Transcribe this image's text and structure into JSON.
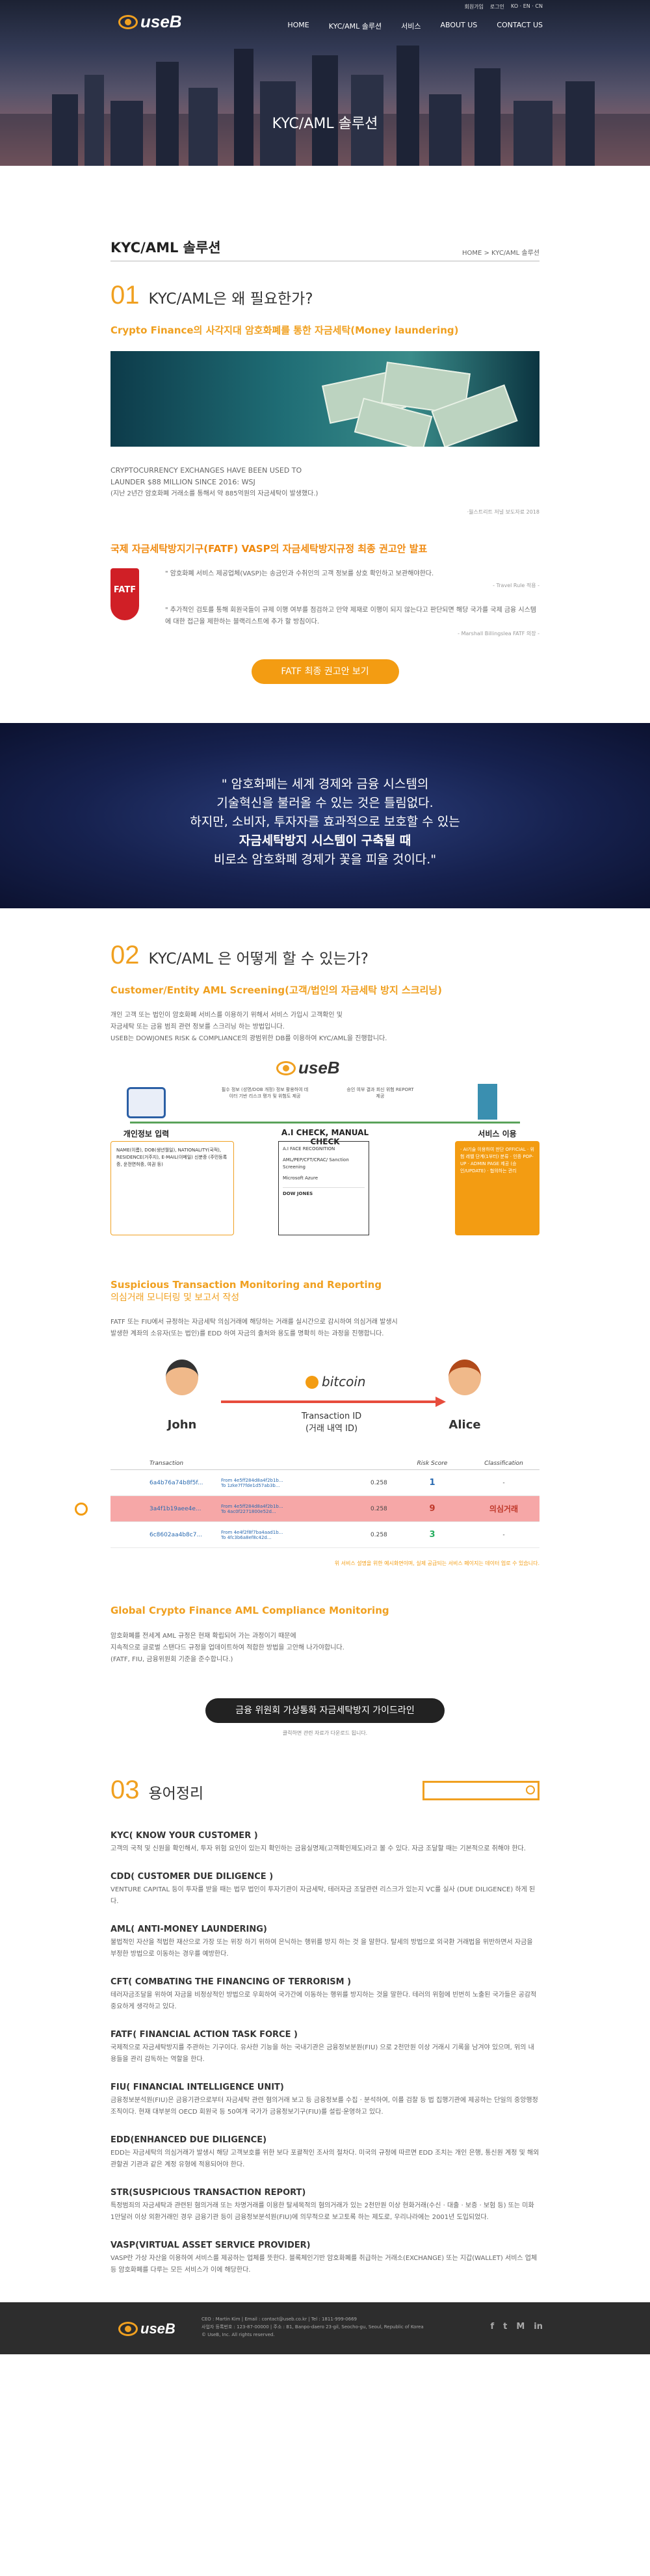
{
  "header": {
    "logo_text": "useB",
    "top_links": [
      "회원가입",
      "로그인",
      "KO · EN · CN"
    ],
    "nav": [
      "HOME",
      "KYC/AML 솔루션",
      "서비스",
      "ABOUT US",
      "CONTACT US"
    ]
  },
  "hero": {
    "title": "KYC/AML 솔루션"
  },
  "page": {
    "title": "KYC/AML 솔루션",
    "breadcrumb": "HOME  >  KYC/AML 솔루션"
  },
  "section1": {
    "num": "01",
    "title": "KYC/AML은 왜 필요한가?",
    "subtitle": "Crypto Finance의 사각지대 암호화폐를 통한 자금세탁(Money laundering)",
    "image_caption_en": "CRYPTOCURRENCY EXCHANGES HAVE BEEN USED TO LAUNDER $88 MILLION SINCE 2016: WSJ",
    "image_caption_ko": "(지난 2년간 암호화폐 거래소를 통해서 약 885억원의 자금세탁이 발생했다.)",
    "image_source": "·월스트리트 저널 보도자료 2018",
    "fatf_heading": "국제 자금세탁방지기구(FATF) VASP의 자금세탁방지규정 최종 권고안 발표",
    "fatf_logo": "FATF",
    "quote1": "\" 암호화폐 서비스 제공업체(VASP)는 송금인과 수취인의 고객 정보를 상호 확인하고 보관해야한다.",
    "quote1_src": "- Travel Rule 적용 -",
    "quote2": "\" 추가적인 검토를 통해 회원국들이 규제 이행 여부를 점검하고 만약 제재로 이행이 되지 않는다고 판단되면 해당 국가를 국제 금융 시스템에 대한 접근을 제한하는 블랙리스트에 추가 할 방침이다.",
    "quote2_src": "- Marshall Billingslea FATF 의장 -",
    "button": "FATF 최종 권고안 보기"
  },
  "quote_band": {
    "line1": "\" 암호화폐는 세계 경제와 금융 시스템의",
    "line2": "기술혁신을 불러올 수 있는 것은 틀림없다.",
    "line3": "하지만, 소비자, 투자자를 효과적으로 보호할 수 있는",
    "line4": "자금세탁방지 시스템이 구축될 때",
    "line5": "비로소 암호화폐 경제가 꽃을 피울 것이다.\""
  },
  "section2": {
    "num": "02",
    "title": "KYC/AML 은 어떻게 할 수 있는가?",
    "sub1": "Customer/Entity AML Screening(고객/법인의 자금세탁 방지 스크리닝)",
    "sub1_text1": "개인 고객 또는 법인이 암호화폐 서비스를 이용하기 위해서 서비스 가입시 고객확인 및",
    "sub1_text2": "자금세탁 또는 금융 범죄 관련 정보를 스크리닝 하는 방법입니다.",
    "sub1_text3": "USEB는 DOWJONES RISK & COMPLIANCE의 광범위한 DB를 이용하여 KYC/AML을 진행합니다.",
    "diag_logo": "useB",
    "diag_note_left": "필수 정보 (성명/DOB 개정) 정보 활용하여 데이터 기반 리스크 평가 및 위험도 제공",
    "diag_note_right": "승인 여부 결과 회신 위험 REPORT 제공",
    "col1_title": "개인정보 입력",
    "col2_title": "A.I CHECK, MANUAL CHECK",
    "col3_title": "서비스 이용",
    "col1_text": "NAME(이름), DOB(생년월일), NATIONALITY(국적), RESIDENCE(거주지), E-MAIL(이메일) 신분증 (주민등록증, 운전면허증, 여권 등)",
    "col2_items": [
      "A.I FACE RECOGNITION",
      "AML/PEP/CFT/CRAC/ Sanction Screening",
      "Microsoft Azure",
      "DOW JONES"
    ],
    "col3_text": "· AI기술 이용하여 판단 OFFICIAL · 위험 레벨 단계(1부터) 분류 · 인증 POP-UP · ADMIN PAGE 제공 (승인/UPDATE) · 협의하는 관리",
    "sub2": "Suspicious Transaction Monitoring and Reporting",
    "sub2_ko": "의심거래 모니터링 및 보고서 작성",
    "sub2_text1": "FATF 또는 FIU에서 규정하는 자금세탁 의심거래에 해당하는 거래를 실시간으로 감시하여 의심거래 발생시",
    "sub2_text2": "발생한 계좌의 소유자(또는 법인)를 EDD 하여 자금의 출처와 용도를 명확히 하는 과정을 진행합니다.",
    "person_left": "John",
    "person_right": "Alice",
    "coin": "bitcoin",
    "tx_label": "Transaction ID",
    "tx_label_ko": "(거래 내역 ID)",
    "table_headers": [
      "Transaction",
      "Risk Score",
      "Classification"
    ],
    "tx_rows": [
      {
        "hash": "6a4b76a74b8f5f...",
        "from": "From 4e5ff284d8a4f2b1b...",
        "to": "To 1zke7f7fde1d57ab3b...",
        "amt": "0.258",
        "score": "1",
        "cls": "-"
      },
      {
        "hash": "3a4f1b19aee4e...",
        "from": "From 4e5ff284d8a4f2b1b...",
        "to": "To 4ac0f2271800e52d...",
        "amt": "0.258",
        "score": "9",
        "cls": "의심거래"
      },
      {
        "hash": "6c8602aa4b8c7...",
        "from": "From 4e4f2f8f7ba4aad1b...",
        "to": "To 4fc3b6a8ef8c42d...",
        "amt": "0.258",
        "score": "3",
        "cls": "-"
      }
    ],
    "tx_note": "위 서비스 설명을 위한 예시화면이며, 실제 공급되는 서비스 페이지는 데이터 업로 수 있습니다.",
    "sub3": "Global Crypto Finance AML Compliance Monitoring",
    "sub3_text1": "암호화폐를 전세계 AML 규정은 현재 확립되어 가는 과정이기 때문에",
    "sub3_text2": "지속적으로 글로벌 스탠다드 규정을 업데이트하여 적합한 방법을 고안해 나가야합니다.",
    "sub3_text3": "(FATF, FIU, 금융위원회 기준을 준수합니다.)",
    "black_button": "금융 위원회 가상통화 자금세탁방지 가이드라인",
    "black_button_note": "클릭하면 관련 자료가 다운로드 됩니다."
  },
  "section3": {
    "num": "03",
    "title": "용어정리",
    "search_placeholder": "",
    "terms": [
      {
        "h": "KYC( KNOW YOUR CUSTOMER )",
        "t": "고객의 국적 및 신원을 확인해서, 투자 위험 요인이 있는지 확인하는 금융실명제(고객확인제도)라고 볼 수 있다. 자금 조달할 때는 기본적으로 취해야 한다."
      },
      {
        "h": "CDD( CUSTOMER DUE DILIGENCE )",
        "t": "VENTURE CAPITAL 등이 투자를 받을 때는 법무 법인이 투자기관이 자금세탁, 테러자금 조달관련 리스크가 있는지 VC를 실사 (DUE DILIGENCE) 하게 된다."
      },
      {
        "h": "AML( ANTI-MONEY LAUNDERING)",
        "t": "불법적인 자산을 적법한 재산으로 가장 또는 위장 하기 위하여 은닉하는 행위를 방지 하는 것 을 말한다. 탈세의 방법으로 외국환 거래법을 위반하면서 자금을 부정한 방법으로 이동하는 경우를 예방한다."
      },
      {
        "h": "CFT( COMBATING THE FINANCING OF TERRORISM )",
        "t": "테러자금조달을 위하여 자금을 비정상적인 방법으로 우회하여 국가간에 이동하는 행위를 방지하는 것을 말한다. 테러의 위험에 빈번히 노출된 국가들은 공감적 중요하게 생각하고 있다."
      },
      {
        "h": "FATF( FINANCIAL ACTION TASK FORCE )",
        "t": "국제적으로 자금세탁방지를 주관하는 기구이다. 유사한 기능을 하는 국내기관은 금융정보분원(FIU) 으로 2천만원 이상 거래시 기록을 남겨야 있으며, 위의 내용들을 관리 감독하는 역할을 한다."
      },
      {
        "h": "FIU( FINANCIAL INTELLIGENCE UNIT)",
        "t": "금융정보분석원(FIU)은 금융기관으로부터 자금세탁 관련 혐의거래 보고 등 금융정보를 수집 · 분석하여, 이를 검찰 등 법 집행기관에 제공하는 단일의 중앙행정조직이다. 현재 대부분의 OECD 회원국 등 50여개 국가가 금융정보기구(FIU)를 설립·운영하고 있다."
      },
      {
        "h": "EDD(ENHANCED DUE DILIGENCE)",
        "t": "EDD는 자금세탁의 의심거래가 발생시 해당 고객보호를 위한 보다 포괄적인 조사의 절차다. 미국의 규정에 따르면 EDD 조치는 개인 은행, 통신원 계정 및 해외 관할권 기관과 같은 계정 유형에 적용되어야 한다."
      },
      {
        "h": "STR(SUSPICIOUS TRANSACTION REPORT)",
        "t": "특정범죄의 자금세탁과 관련된 혐의거래 또는 차명거래를 이용한 탈세목적의 혐의거래가 있는 2천만원 이상 현화거래(수신 · 대출 · 보증 · 보험 등) 또는 미화 1만달러 이상 외환거래인 경우 금융기관 등이 금융정보분석원(FIU)에 의무적으로 보고토록 하는 제도로, 우리나라에는 2001년 도입되었다."
      },
      {
        "h": "VASP(VIRTUAL ASSET SERVICE PROVIDER)",
        "t": "VASP란 가상 자산을 이용하여 서비스를 제공하는 업체를 뜻한다. 블록체인기반 암호화폐를 취급하는 거래소(EXCHANGE) 또는 지갑(WALLET) 서비스 업체 등 암호화폐를 다루는 모든 서비스가 이에 해당한다."
      }
    ]
  },
  "footer": {
    "logo_text": "useB",
    "line1": "CEO : Martin Kim  |  Email : contact@useb.co.kr  |  Tel : 1811-999-0669",
    "line2": "사업자 등록번호 : 123-87-00000  |  주소 : B1, Banpo-daero 23-gil, Seocho-gu, Seoul, Republic of Korea",
    "line3": "© UseB, Inc. All rights reserved.",
    "social": [
      "f",
      "t",
      "M",
      "in"
    ]
  },
  "colors": {
    "accent": "#f39c12",
    "dark": "#222222",
    "risk": "#e74c3c",
    "footer": "#2d2d2d"
  }
}
